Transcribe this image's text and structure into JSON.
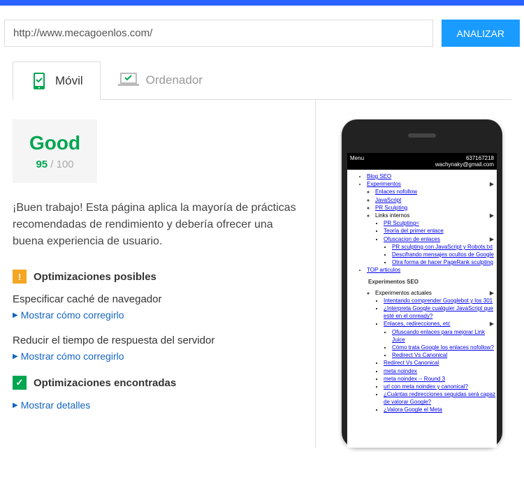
{
  "url_value": "http://www.mecagoenlos.com/",
  "analyze_button": "ANALIZAR",
  "tabs": {
    "mobile": "Móvil",
    "desktop": "Ordenador"
  },
  "score": {
    "label": "Good",
    "value": "95",
    "max": " / 100"
  },
  "description": "¡Buen trabajo! Esta página aplica la mayoría de prácticas recomendadas de rendimiento y debería ofrecer una buena experiencia de usuario.",
  "sections": {
    "possible": {
      "title": "Optimizaciones posibles",
      "items": [
        {
          "title": "Especificar caché de navegador",
          "link": "Mostrar cómo corregirlo"
        },
        {
          "title": "Reducir el tiempo de respuesta del servidor",
          "link": "Mostrar cómo corregirlo"
        }
      ]
    },
    "found": {
      "title": "Optimizaciones encontradas",
      "link": "Mostrar detalles"
    }
  },
  "phone": {
    "menu": "Menu",
    "phone_num": "637167218",
    "email": "wachynaky@gmail.com",
    "links": {
      "blog": "Blog SEO",
      "exp": "Experimentos",
      "nofollow": "Enlaces nofollow",
      "js": "JavaScript",
      "prs": "PR Sculpting",
      "internos": "Links internos",
      "prs2": "PR Sculpting<",
      "teoria": "Teoría del primer enlace",
      "ofusc": "Ofuscacion de enlaces",
      "prsjs": "PR sculpting con JavaScript y Robots.txt",
      "descif": "Descifrando mensajes ocultos de Google",
      "otra": "Otra forma de hacer PageRank sculpting",
      "top": "TOP articulos",
      "expseo": "Experimentos SEO",
      "expact": "Experimentos actuales",
      "intent": "Intentando comprender Googlebot y los 301",
      "interp": "¿Interpreta Google cualquier JavaScript que esté en el onready?",
      "redir": "Enlaces, redirecciones, etc",
      "ofusc2": "Ofuscando enlaces para mejorar Link Juice",
      "trata": "Cómo trata Google los enlaces nofollow?",
      "rvc": "Redirect Vs Canonical",
      "rvc2": "Redirect Vs Canonical",
      "mnoi": "meta noindex",
      "mnoi3": "meta noindex -- Round 3",
      "urlmeta": "url con meta noindex y canonical?",
      "cuantas": "¿Cuántas redirecciones seguidas será capaz de valorar Google?",
      "valora": "¿Valora Google el Meta"
    }
  }
}
